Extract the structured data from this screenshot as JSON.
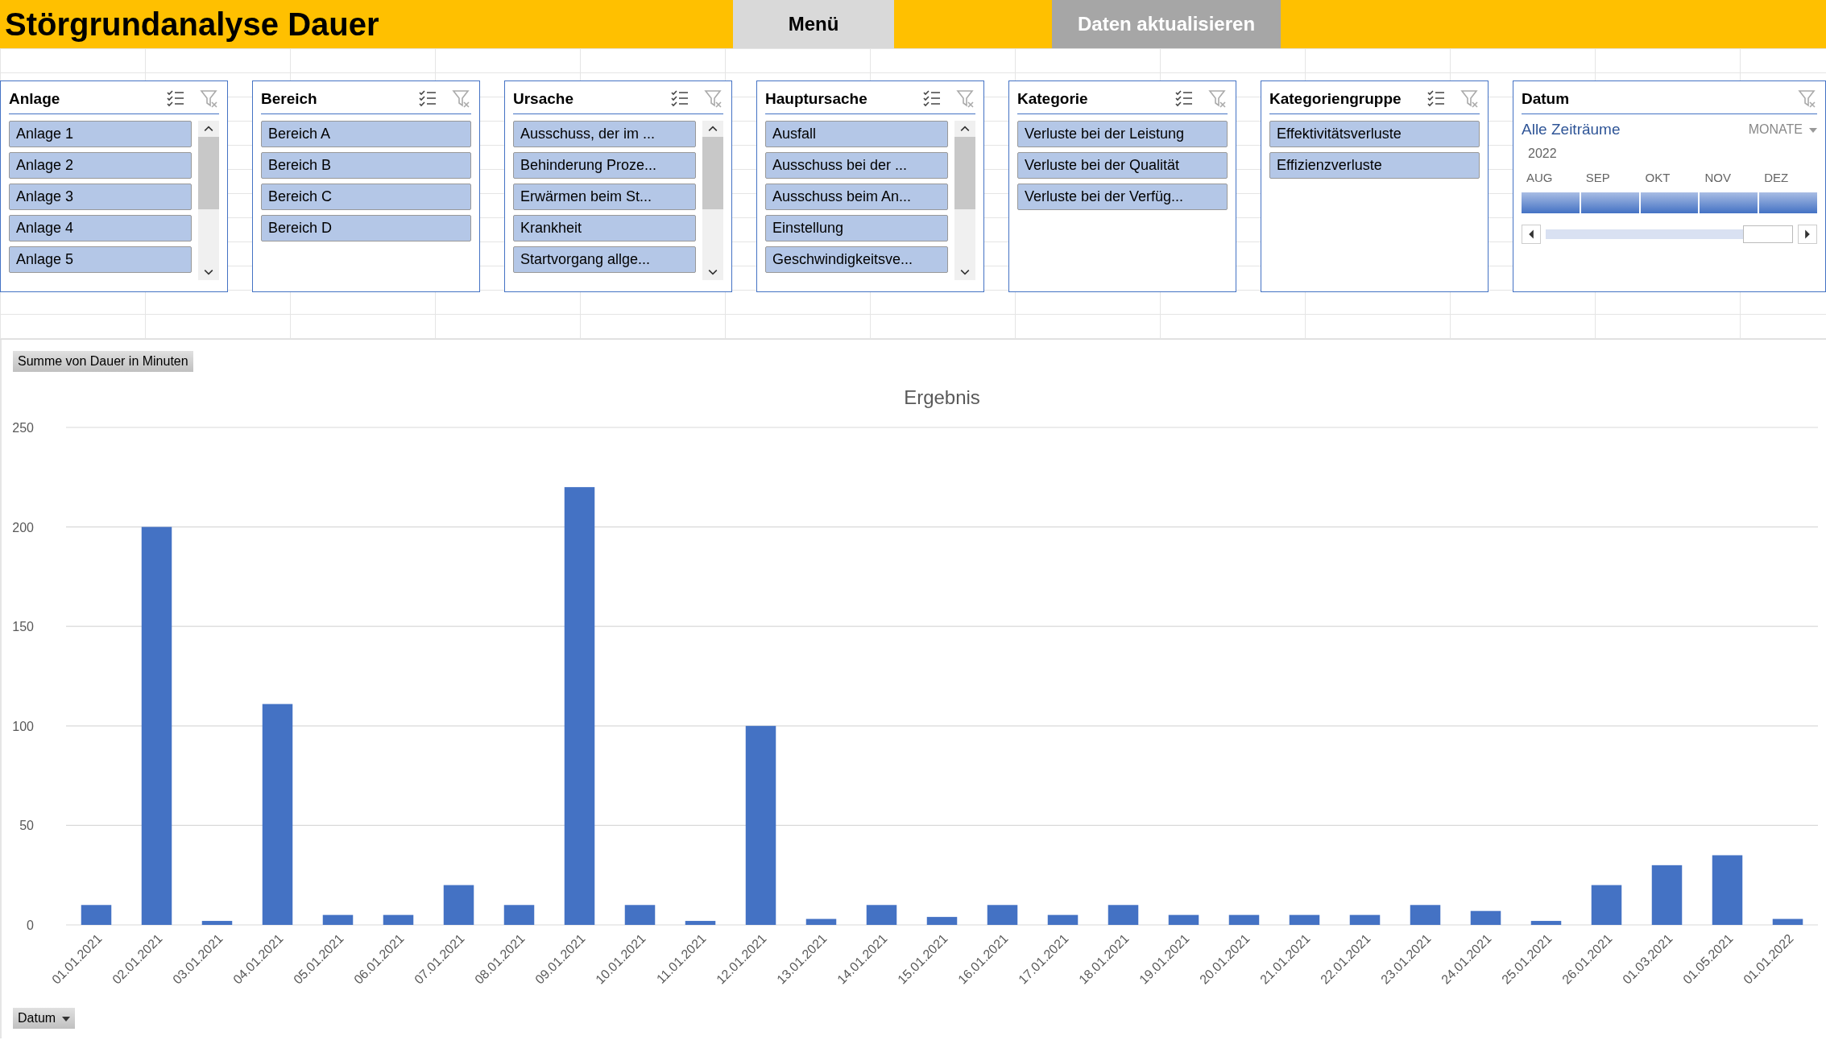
{
  "header": {
    "title": "Störgrundanalyse Dauer",
    "buttons": [
      {
        "label": "Menü",
        "kind": "menu"
      },
      {
        "label": "Daten aktualisieren",
        "kind": "refresh"
      }
    ]
  },
  "slicers": [
    {
      "title": "Anlage",
      "scrollbar": true,
      "items": [
        {
          "label": "Anlage 1",
          "selected": true
        },
        {
          "label": "Anlage 2",
          "selected": true
        },
        {
          "label": "Anlage 3",
          "selected": true
        },
        {
          "label": "Anlage 4",
          "selected": true
        },
        {
          "label": "Anlage 5",
          "selected": true
        }
      ]
    },
    {
      "title": "Bereich",
      "scrollbar": false,
      "items": [
        {
          "label": "Bereich A",
          "selected": true
        },
        {
          "label": "Bereich B",
          "selected": true
        },
        {
          "label": "Bereich C",
          "selected": true
        },
        {
          "label": "Bereich D",
          "selected": true
        }
      ]
    },
    {
      "title": "Ursache",
      "scrollbar": true,
      "items": [
        {
          "label": "Ausschuss, der im ...",
          "selected": true
        },
        {
          "label": "Behinderung Proze...",
          "selected": true
        },
        {
          "label": "Erwärmen beim St...",
          "selected": true
        },
        {
          "label": "Krankheit",
          "selected": true
        },
        {
          "label": "Startvorgang allge...",
          "selected": true
        }
      ]
    },
    {
      "title": "Hauptursache",
      "scrollbar": true,
      "items": [
        {
          "label": "Ausfall",
          "selected": true
        },
        {
          "label": "Ausschuss bei der ...",
          "selected": true
        },
        {
          "label": "Ausschuss beim An...",
          "selected": true
        },
        {
          "label": "Einstellung",
          "selected": true
        },
        {
          "label": "Geschwindigkeitsve...",
          "selected": true
        }
      ]
    },
    {
      "title": "Kategorie",
      "scrollbar": false,
      "items": [
        {
          "label": "Verluste bei der Leistung",
          "selected": true
        },
        {
          "label": "Verluste bei der Qualität",
          "selected": true
        },
        {
          "label": "Verluste bei der Verfüg...",
          "selected": true
        }
      ]
    },
    {
      "title": "Kategoriengruppe",
      "scrollbar": false,
      "items": [
        {
          "label": "Effektivitätsverluste",
          "selected": true
        },
        {
          "label": "Effizienzverluste",
          "selected": true
        }
      ]
    }
  ],
  "timeline": {
    "title": "Datum",
    "period": "Alle Zeiträume",
    "unit": "MONATE",
    "year": "2022",
    "months": [
      {
        "label": "AUG",
        "selected": true
      },
      {
        "label": "SEP",
        "selected": true
      },
      {
        "label": "OKT",
        "selected": true
      },
      {
        "label": "NOV",
        "selected": true
      },
      {
        "label": "DEZ",
        "selected": true
      }
    ]
  },
  "chart": {
    "field_button": "Summe von Dauer in Minuten",
    "axis_button": "Datum",
    "chart_data": {
      "type": "bar",
      "title": "Ergebnis",
      "categories": [
        "01.01.2021",
        "02.01.2021",
        "03.01.2021",
        "04.01.2021",
        "05.01.2021",
        "06.01.2021",
        "07.01.2021",
        "08.01.2021",
        "09.01.2021",
        "10.01.2021",
        "11.01.2021",
        "12.01.2021",
        "13.01.2021",
        "14.01.2021",
        "15.01.2021",
        "16.01.2021",
        "17.01.2021",
        "18.01.2021",
        "19.01.2021",
        "20.01.2021",
        "21.01.2021",
        "22.01.2021",
        "23.01.2021",
        "24.01.2021",
        "25.01.2021",
        "26.01.2021",
        "01.03.2021",
        "01.05.2021",
        "01.01.2022"
      ],
      "series": [
        {
          "color": "#4472c4",
          "values": [
            10,
            200,
            2,
            111,
            5,
            5,
            20,
            10,
            220,
            10,
            2,
            100,
            3,
            10,
            4,
            10,
            5,
            10,
            5,
            5,
            5,
            5,
            10,
            7,
            2,
            20,
            30,
            35,
            3
          ]
        }
      ],
      "ylim": [
        0,
        250
      ],
      "grid": true,
      "yticks": [
        0,
        50,
        100,
        150,
        200,
        250
      ]
    }
  }
}
